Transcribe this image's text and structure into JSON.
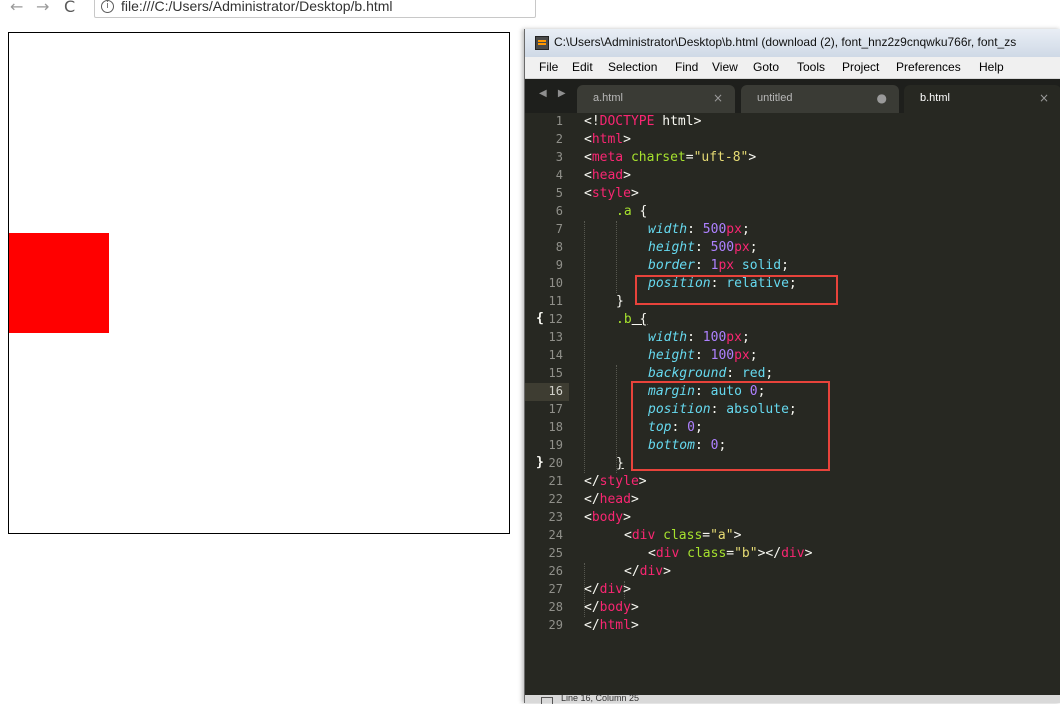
{
  "browser": {
    "back_icon": "←",
    "forward_icon": "→",
    "reload_icon": "C",
    "info_icon": "i",
    "url": "file:///C:/Users/Administrator/Desktop/b.html"
  },
  "rendered_page": {
    "box_border_color": "#000000",
    "red_box_color": "#ff0000"
  },
  "editor": {
    "title": "C:\\Users\\Administrator\\Desktop\\b.html (download (2), font_hnz2z9cnqwku766r, font_zs",
    "menu": [
      "File",
      "Edit",
      "Selection",
      "Find",
      "View",
      "Goto",
      "Tools",
      "Project",
      "Preferences",
      "Help"
    ],
    "tabs": [
      {
        "label": "a.html",
        "close": "×"
      },
      {
        "label": "untitled",
        "close": "●"
      },
      {
        "label": "b.html",
        "close": "×"
      }
    ],
    "tab_arrows": "◀ ▶",
    "line_numbers": [
      "1",
      "2",
      "3",
      "4",
      "5",
      "6",
      "7",
      "8",
      "9",
      "10",
      "11",
      "12",
      "13",
      "14",
      "15",
      "16",
      "17",
      "18",
      "19",
      "20",
      "21",
      "22",
      "23",
      "24",
      "25",
      "26",
      "27",
      "28",
      "29"
    ],
    "fold_markers": {
      "open": "{",
      "close": "}"
    },
    "status_text": "Line 16, Column 25",
    "colors": {
      "background": "#272822",
      "tag": "#f92672",
      "attribute": "#a6e22e",
      "string": "#e6db74",
      "number": "#ae81ff",
      "property": "#66d9ef",
      "highlight_box": "#e8433b"
    },
    "code_tokens": {
      "l1": [
        "<!",
        "DOCTYPE",
        " html>"
      ],
      "l2": [
        "<",
        "html",
        ">"
      ],
      "l3": [
        "<",
        "meta",
        " ",
        "charset",
        "=",
        "\"uft-8\"",
        ">"
      ],
      "l4": [
        "<",
        "head",
        ">"
      ],
      "l5": [
        "<",
        "style",
        ">"
      ],
      "l6": [
        ".a",
        " {"
      ],
      "l7": [
        "width",
        ": ",
        "500",
        "px",
        ";"
      ],
      "l8": [
        "height",
        ": ",
        "500",
        "px",
        ";"
      ],
      "l9": [
        "border",
        ": ",
        "1",
        "px",
        " solid",
        ";"
      ],
      "l10": [
        "position",
        ": ",
        "relative",
        ";"
      ],
      "l11": [
        "}"
      ],
      "l12": [
        ".b",
        " {"
      ],
      "l13": [
        "width",
        ": ",
        "100",
        "px",
        ";"
      ],
      "l14": [
        "height",
        ": ",
        "100",
        "px",
        ";"
      ],
      "l15": [
        "background",
        ": ",
        "red",
        ";"
      ],
      "l16": [
        "margin",
        ": ",
        "auto",
        " ",
        "0",
        ";"
      ],
      "l17": [
        "position",
        ": ",
        "absolute",
        ";"
      ],
      "l18": [
        "top",
        ": ",
        "0",
        ";"
      ],
      "l19": [
        "bottom",
        ": ",
        "0",
        ";"
      ],
      "l20": [
        "}"
      ],
      "l21": [
        "</",
        "style",
        ">"
      ],
      "l22": [
        "</",
        "head",
        ">"
      ],
      "l23": [
        "<",
        "body",
        ">"
      ],
      "l24": [
        "<",
        "div",
        " ",
        "class",
        "=",
        "\"a\"",
        ">"
      ],
      "l25": [
        "<",
        "div",
        " ",
        "class",
        "=",
        "\"b\"",
        "></",
        "div",
        ">"
      ],
      "l26": [
        "</",
        "div",
        ">"
      ],
      "l27": [
        "</",
        "div",
        ">"
      ],
      "l28": [
        "</",
        "body",
        ">"
      ],
      "l29": [
        "</",
        "html",
        ">"
      ]
    }
  }
}
